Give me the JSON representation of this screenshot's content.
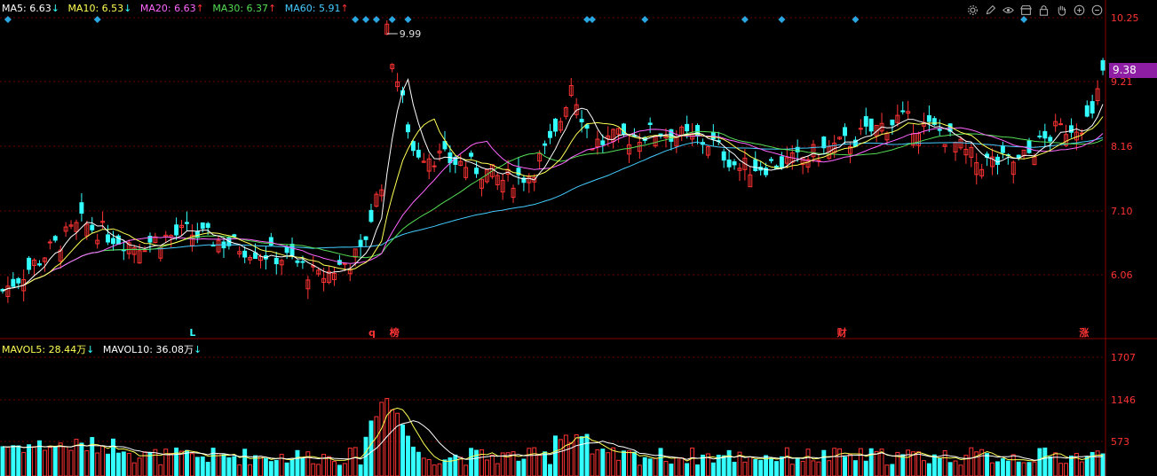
{
  "legend": {
    "ma5": {
      "label": "MA5: 6.63",
      "arrow": "↓",
      "color": "#ffffff"
    },
    "ma10": {
      "label": "MA10: 6.53",
      "arrow": "↓",
      "color": "#ffff55"
    },
    "ma20": {
      "label": "MA20: 6.63",
      "arrow": "↑",
      "color": "#ff66ff"
    },
    "ma30": {
      "label": "MA30: 6.37",
      "arrow": "↑",
      "color": "#55dd55"
    },
    "ma60": {
      "label": "MA60: 5.91",
      "arrow": "↑",
      "color": "#44ccff"
    }
  },
  "vol_legend": {
    "mavol5": {
      "label": "MAVOL5: 28.44万",
      "arrow": "↓",
      "color": "#ffff55"
    },
    "mavol10": {
      "label": "MAVOL10: 36.08万",
      "arrow": "↓",
      "color": "#ffffff"
    }
  },
  "current_price": "9.38",
  "toolbar_icons": [
    "settings-icon",
    "pencil-icon",
    "eye-icon",
    "store-icon",
    "lock-icon",
    "hand-icon",
    "zoom-in-icon",
    "zoom-out-icon"
  ],
  "colors": {
    "up": "#ff3333",
    "down": "#33ffff",
    "grid": "#6a0000",
    "axis_text": "#ff3333",
    "marker": "#2aa6e0"
  },
  "chart_data": [
    {
      "type": "candlestick",
      "title": "",
      "ylim": [
        5.3,
        10.4
      ],
      "y_ticks": [
        "10.25",
        "9.21",
        "8.16",
        "7.10",
        "6.06"
      ],
      "annotations": [
        {
          "label": "9.99",
          "kind": "period-high"
        }
      ],
      "event_markers": [
        {
          "label": "L",
          "color": "#33ffff"
        },
        {
          "label": "q",
          "color": "#ff3333"
        },
        {
          "label": "榜",
          "color": "#ff3333"
        },
        {
          "label": "财",
          "color": "#ff3333"
        },
        {
          "label": "涨",
          "color": "#ff3333"
        }
      ],
      "series": [
        {
          "name": "MA5"
        },
        {
          "name": "MA10"
        },
        {
          "name": "MA20"
        },
        {
          "name": "MA30"
        },
        {
          "name": "MA60"
        }
      ],
      "grid": true
    },
    {
      "type": "bar",
      "title": "",
      "y_ticks": [
        "1707",
        "1146",
        "573"
      ],
      "series": [
        {
          "name": "MAVOL5"
        },
        {
          "name": "MAVOL10"
        }
      ],
      "grid": true
    }
  ]
}
